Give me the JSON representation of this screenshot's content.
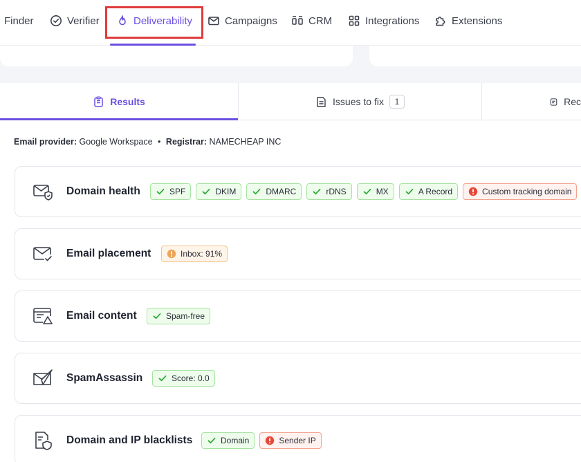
{
  "nav": {
    "items": [
      {
        "label": "Finder",
        "icon": "none"
      },
      {
        "label": "Verifier",
        "icon": "check-circle-icon"
      },
      {
        "label": "Deliverability",
        "icon": "flame-icon",
        "active": true
      },
      {
        "label": "Campaigns",
        "icon": "envelope-icon"
      },
      {
        "label": "CRM",
        "icon": "crm-icon"
      },
      {
        "label": "Integrations",
        "icon": "grid-icon"
      },
      {
        "label": "Extensions",
        "icon": "puzzle-icon"
      }
    ]
  },
  "tabs": {
    "results": "Results",
    "issues": "Issues to fix",
    "issues_count": "1",
    "recommendations": "Rec"
  },
  "provider": {
    "provider_label": "Email provider:",
    "provider_value": "Google Workspace",
    "dot": "•",
    "registrar_label": "Registrar:",
    "registrar_value": "NAMECHEAP INC"
  },
  "sections": [
    {
      "title": "Domain health",
      "icon": "shield-envelope-icon",
      "badges": [
        {
          "label": "SPF",
          "status": "ok"
        },
        {
          "label": "DKIM",
          "status": "ok"
        },
        {
          "label": "DMARC",
          "status": "ok"
        },
        {
          "label": "rDNS",
          "status": "ok"
        },
        {
          "label": "MX",
          "status": "ok"
        },
        {
          "label": "A Record",
          "status": "ok"
        },
        {
          "label": "Custom tracking domain",
          "status": "error"
        }
      ]
    },
    {
      "title": "Email placement",
      "icon": "envelope-check-icon",
      "badges": [
        {
          "label": "Inbox: 91%",
          "status": "warning"
        }
      ]
    },
    {
      "title": "Email content",
      "icon": "content-warning-icon",
      "badges": [
        {
          "label": "Spam-free",
          "status": "ok"
        }
      ]
    },
    {
      "title": "SpamAssassin",
      "icon": "paper-plane-icon",
      "badges": [
        {
          "label": "Score: 0.0",
          "status": "ok"
        }
      ]
    },
    {
      "title": "Domain and IP blacklists",
      "icon": "document-shield-icon",
      "badges": [
        {
          "label": "Domain",
          "status": "ok"
        },
        {
          "label": "Sender IP",
          "status": "error"
        }
      ]
    }
  ],
  "colors": {
    "accent": "#6a4fe0",
    "ok_border": "#a6e3a0",
    "warn_border": "#f2c48f",
    "error_border": "#f2a48e",
    "highlight": "#e03c3c"
  }
}
